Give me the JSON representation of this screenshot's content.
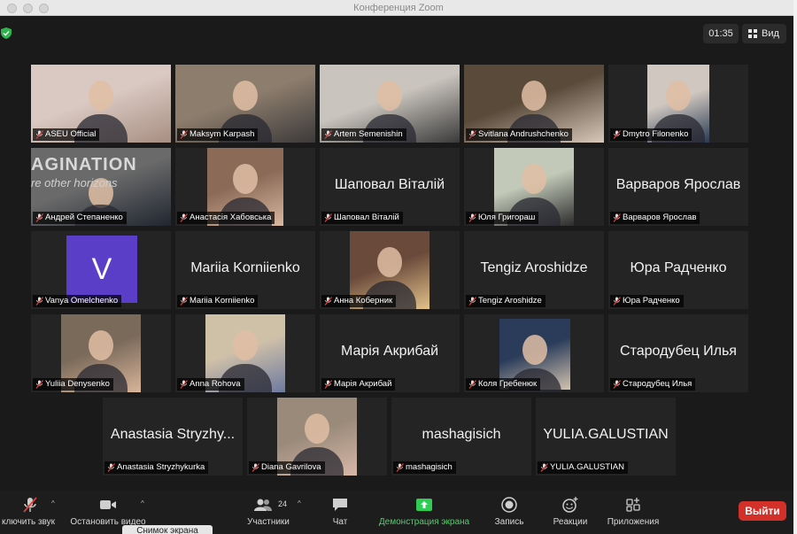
{
  "window": {
    "title": "Конференция Zoom"
  },
  "top": {
    "timer": "01:35",
    "view_label": "Вид"
  },
  "tiles": [
    {
      "name": "ASEU Official",
      "type": "video"
    },
    {
      "name": "Maksym Karpash",
      "type": "video"
    },
    {
      "name": "Artem Semenishin",
      "type": "video",
      "active": true
    },
    {
      "name": "Svitlana Andrushchenko",
      "type": "video"
    },
    {
      "name": "Dmytro Filonenko",
      "type": "video"
    },
    {
      "name": "Андрей Степаненко",
      "type": "video",
      "bg_text": "AGINATION",
      "bg_text2": "re other horizons"
    },
    {
      "name": "Анастасія Хабовська",
      "type": "video"
    },
    {
      "name": "Шаповал Віталій",
      "type": "name",
      "display": "Шаповал Віталій"
    },
    {
      "name": "Юля Григораш",
      "type": "video"
    },
    {
      "name": "Варваров Ярослав",
      "type": "name",
      "display": "Варваров Ярослав"
    },
    {
      "name": "Vanya Omelchenko",
      "type": "avatar",
      "letter": "V"
    },
    {
      "name": "Mariia Korniienko",
      "type": "name",
      "display": "Mariia Korniienko"
    },
    {
      "name": "Анна Коберник",
      "type": "video"
    },
    {
      "name": "Tengiz Aroshidze",
      "type": "name",
      "display": "Tengiz Aroshidze"
    },
    {
      "name": "Юра Радченко",
      "type": "name",
      "display": "Юра Радченко"
    },
    {
      "name": "Yuliia Denysenko",
      "type": "video"
    },
    {
      "name": "Anna Rohova",
      "type": "video"
    },
    {
      "name": "Марія Акрибай",
      "type": "name",
      "display": "Марія Акрибай"
    },
    {
      "name": "Коля Гребенюк",
      "type": "video"
    },
    {
      "name": "Стародубец Илья",
      "type": "name",
      "display": "Стародубец Илья"
    },
    {
      "name": "Anastasia Stryzhykurka",
      "type": "name",
      "display": "Anastasia Stryzhy..."
    },
    {
      "name": "Diana Gavrilova",
      "type": "video"
    },
    {
      "name": "mashagisich",
      "type": "name",
      "display": "mashagisich"
    },
    {
      "name": "YULIA.GALUSTIAN",
      "type": "name",
      "display": "YULIA.GALUSTIAN"
    }
  ],
  "toolbar": {
    "mute_label": "ключить звук",
    "video_label": "Остановить видео",
    "participants_label": "Участники",
    "participants_count": "24",
    "chat_label": "Чат",
    "share_label": "Демонстрация экрана",
    "record_label": "Запись",
    "reactions_label": "Реакции",
    "apps_label": "Приложения",
    "leave_label": "Выйти",
    "tooltip": "Снимок экрана"
  },
  "colors": {
    "active_border": "#cde28a",
    "leave": "#d3302a",
    "share_green": "#4fd06a",
    "avatar": "#5a3ec7"
  }
}
